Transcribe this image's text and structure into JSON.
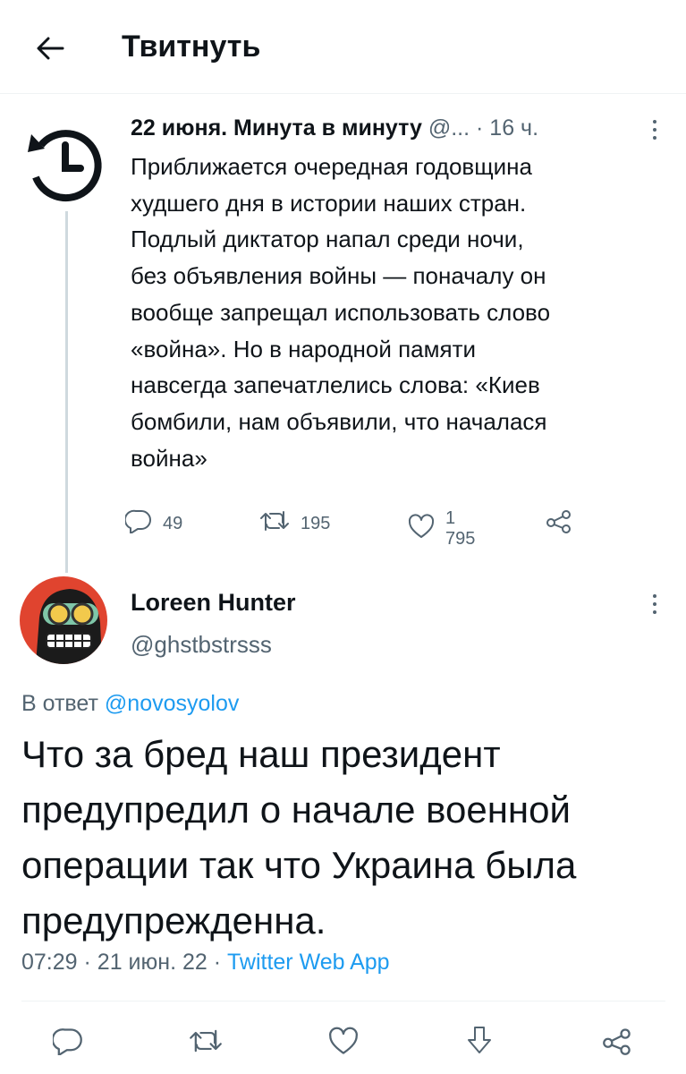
{
  "header": {
    "title": "Твитнуть"
  },
  "quoted_tweet": {
    "author_name": "22 июня. Минута в минуту",
    "author_handle": "@...",
    "time": "· 16 ч.",
    "text": "Приближается очередная годовщина\nхудшего дня в истории наших стран.\nПодлый диктатор напал среди ночи,\nбез объявления войны — поначалу он\nвообще запрещал использовать слово\n«война». Но в народной памяти\nнавсегда запечатлелись слова: «Киев\nбомбили, нам объявили, что началася\nвойна»",
    "replies": "49",
    "retweets": "195",
    "likes": "1 795"
  },
  "tweet": {
    "author_name": "Loreen Hunter",
    "author_handle": "@ghstbstrsss",
    "reply_prefix": "В ответ",
    "reply_to": "@novosyolov",
    "text": "Что за бред наш президент\nпредупредил о начале военной\nоперации так что Украина была\nпредупрежденна.",
    "time": "07:29",
    "date": "21 июн. 22",
    "source": "Twitter Web App"
  },
  "colors": {
    "accent": "#1d9bf0",
    "secondary_text": "#536471",
    "divider": "#eff3f4"
  },
  "icons": [
    "back-arrow-icon",
    "history-clock-icon",
    "more-icon",
    "reply-icon",
    "retweet-icon",
    "like-icon",
    "share-icon",
    "bookmark-icon",
    "avatar"
  ]
}
